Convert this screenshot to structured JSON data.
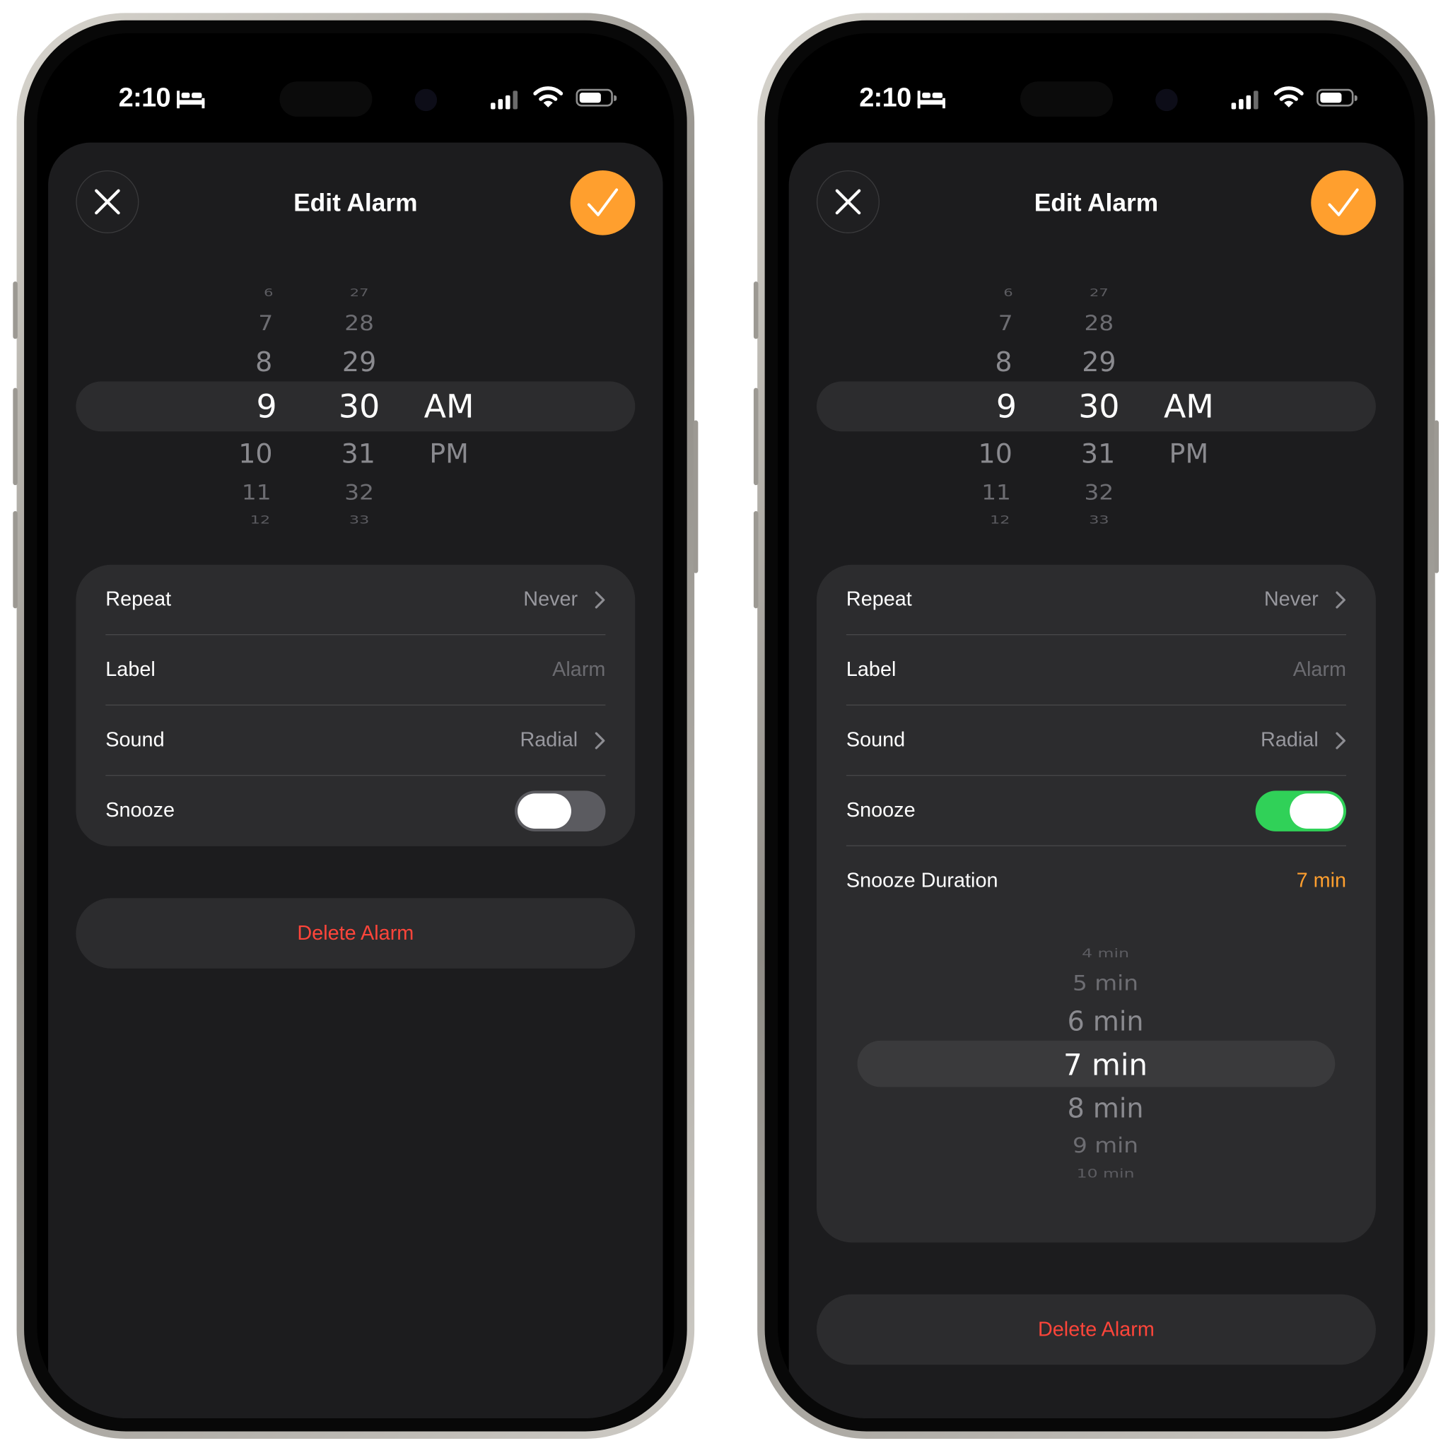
{
  "status_bar": {
    "time": "2:10",
    "icons": [
      "bed-icon",
      "cellular-signal-icon",
      "wifi-icon",
      "battery-icon"
    ]
  },
  "colors": {
    "accent": "#ff9f2e",
    "toggle_on": "#30d158",
    "toggle_off": "#5b5b60",
    "destructive": "#ff453a"
  },
  "left_screen": {
    "header": {
      "title": "Edit Alarm",
      "close_icon": "close-icon",
      "confirm_icon": "checkmark-icon"
    },
    "time_picker": {
      "hours": [
        "6",
        "7",
        "8",
        "9",
        "10",
        "11",
        "12"
      ],
      "minutes": [
        "27",
        "28",
        "29",
        "30",
        "31",
        "32",
        "33"
      ],
      "periods": [
        "AM",
        "PM"
      ],
      "selected_hour": "9",
      "selected_minute": "30",
      "selected_period": "AM"
    },
    "settings": {
      "repeat": {
        "label": "Repeat",
        "value": "Never"
      },
      "label": {
        "label": "Label",
        "placeholder": "Alarm"
      },
      "sound": {
        "label": "Sound",
        "value": "Radial"
      },
      "snooze": {
        "label": "Snooze",
        "enabled": false
      }
    },
    "delete_label": "Delete Alarm"
  },
  "right_screen": {
    "header": {
      "title": "Edit Alarm",
      "close_icon": "close-icon",
      "confirm_icon": "checkmark-icon"
    },
    "time_picker": {
      "hours": [
        "6",
        "7",
        "8",
        "9",
        "10",
        "11",
        "12"
      ],
      "minutes": [
        "27",
        "28",
        "29",
        "30",
        "31",
        "32",
        "33"
      ],
      "periods": [
        "AM",
        "PM"
      ],
      "selected_hour": "9",
      "selected_minute": "30",
      "selected_period": "AM"
    },
    "settings": {
      "repeat": {
        "label": "Repeat",
        "value": "Never"
      },
      "label": {
        "label": "Label",
        "placeholder": "Alarm"
      },
      "sound": {
        "label": "Sound",
        "value": "Radial"
      },
      "snooze": {
        "label": "Snooze",
        "enabled": true
      },
      "snooze_duration": {
        "label": "Snooze Duration",
        "value": "7 min"
      }
    },
    "duration_picker": {
      "options": [
        "4 min",
        "5 min",
        "6 min",
        "7 min",
        "8 min",
        "9 min",
        "10 min"
      ],
      "selected": "7 min"
    },
    "delete_label": "Delete Alarm"
  }
}
